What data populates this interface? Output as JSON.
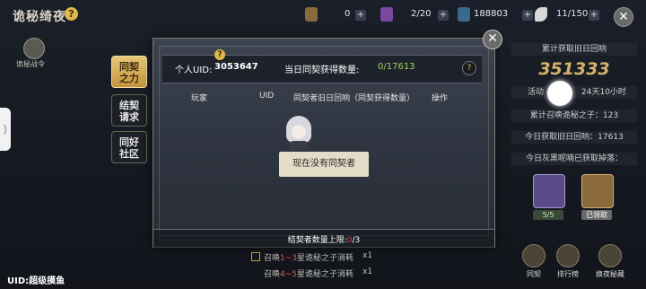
{
  "top": {
    "title": "诡秘绮夜",
    "help_icon": "question-icon",
    "resources": [
      {
        "icon": "currency-icon",
        "value": "0",
        "plus": "+"
      },
      {
        "icon": "potion-icon",
        "value": "2/20",
        "plus": "+"
      },
      {
        "icon": "sword-icon",
        "value": "188803",
        "plus": "+"
      },
      {
        "icon": "feather-icon",
        "value": "11/150",
        "plus": "+"
      }
    ],
    "close": "✕"
  },
  "left": {
    "war_order": "诡秘战令",
    "side_tab": "⟩",
    "nav": [
      {
        "line1": "同契",
        "line2": "之力",
        "active": true
      },
      {
        "line1": "结契",
        "line2": "请求",
        "active": false
      },
      {
        "line1": "同好",
        "line2": "社区",
        "active": false
      }
    ],
    "uid_bottom": "UID:超级摸鱼"
  },
  "right": {
    "total_label": "累计获取旧日回响",
    "total_value": "351333",
    "remain_left": "活动",
    "remain_right": "24天10小时",
    "summon_label": "累计召唤诡秘之子：123",
    "today_label": "今日获取旧日回响：17613",
    "gray_label": "今日灰黑呢喃已获取掉落：",
    "item1_tag": "5/5",
    "item2_tag": "已领取",
    "bottom_nav": [
      "同契",
      "排行榜",
      "换夜秘藏"
    ]
  },
  "bg_rows": [
    {
      "prefix": "召唤",
      "red": "1~3",
      "suffix": "星诡秘之子消耗",
      "qty": "x1"
    },
    {
      "prefix": "召唤",
      "red": "4~5",
      "suffix": "星诡秘之子消耗",
      "qty": "x1"
    }
  ],
  "modal": {
    "uid_label": "个人UID:",
    "uid_value": "3053647",
    "today_label": "当日同契获得数量:",
    "today_value": "0/17613",
    "info": "?",
    "columns": [
      "玩家",
      "UID",
      "同契者旧日回响（同契获得数量）",
      "操作"
    ],
    "empty_text": "现在没有同契者",
    "footer_prefix": "结契者数量上限:",
    "footer_count": "0",
    "footer_suffix": "/3",
    "close": "✕"
  },
  "colors": {
    "accent": "#e0b84a",
    "red": "#e0403a",
    "green": "#9ad45a"
  }
}
